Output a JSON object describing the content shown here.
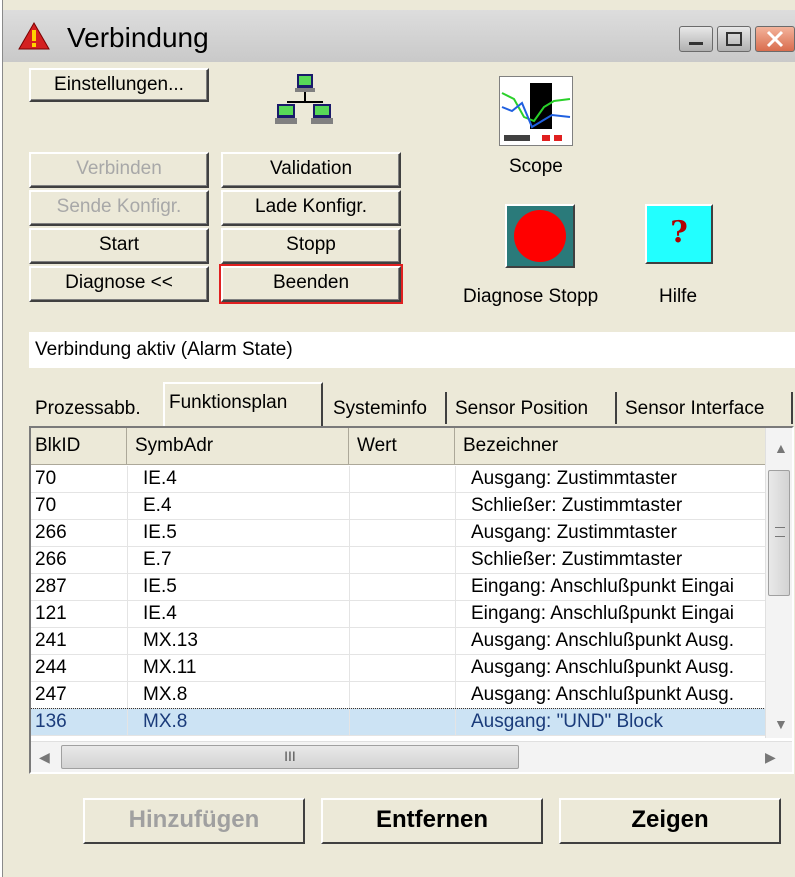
{
  "window": {
    "title": "Verbindung"
  },
  "buttons": {
    "einstellungen": "Einstellungen...",
    "verbinden": "Verbinden",
    "validation": "Validation",
    "sende_konfig": "Sende Konfigr.",
    "lade_konfig": "Lade Konfigr.",
    "start": "Start",
    "stopp": "Stopp",
    "diagnose": "Diagnose <<",
    "beenden": "Beenden"
  },
  "tools": {
    "scope_label": "Scope",
    "diagnose_stopp_label": "Diagnose Stopp",
    "hilfe_label": "Hilfe",
    "hilfe_glyph": "?"
  },
  "status": {
    "text": "Verbindung aktiv (Alarm State)"
  },
  "tabs": [
    {
      "label": "Prozessabb."
    },
    {
      "label": "Funktionsplan"
    },
    {
      "label": "Systeminfo"
    },
    {
      "label": "Sensor Position"
    },
    {
      "label": "Sensor Interface"
    }
  ],
  "table": {
    "columns": [
      "BlkID",
      "SymbAdr",
      "Wert",
      "Bezeichner"
    ],
    "rows": [
      {
        "blkid": "70",
        "symbadr": "IE.4",
        "wert": "",
        "bezeichner": "Ausgang: Zustimmtaster"
      },
      {
        "blkid": "70",
        "symbadr": "E.4",
        "wert": "",
        "bezeichner": "Schließer: Zustimmtaster"
      },
      {
        "blkid": "266",
        "symbadr": "IE.5",
        "wert": "",
        "bezeichner": "Ausgang: Zustimmtaster"
      },
      {
        "blkid": "266",
        "symbadr": "E.7",
        "wert": "",
        "bezeichner": "Schließer: Zustimmtaster"
      },
      {
        "blkid": "287",
        "symbadr": "IE.5",
        "wert": "",
        "bezeichner": "Eingang: Anschlußpunkt Eingai"
      },
      {
        "blkid": "121",
        "symbadr": "IE.4",
        "wert": "",
        "bezeichner": "Eingang: Anschlußpunkt Eingai"
      },
      {
        "blkid": "241",
        "symbadr": "MX.13",
        "wert": "",
        "bezeichner": "Ausgang: Anschlußpunkt Ausg."
      },
      {
        "blkid": "244",
        "symbadr": "MX.11",
        "wert": "",
        "bezeichner": "Ausgang: Anschlußpunkt Ausg."
      },
      {
        "blkid": "247",
        "symbadr": "MX.8",
        "wert": "",
        "bezeichner": "Ausgang: Anschlußpunkt Ausg."
      },
      {
        "blkid": "136",
        "symbadr": "MX.8",
        "wert": "",
        "bezeichner": "Ausgang: \"UND\" Block",
        "selected": true
      }
    ]
  },
  "scrollbar": {
    "grip": "III"
  },
  "bottom": {
    "hinzufuegen": "Hinzufügen",
    "entfernen": "Entfernen",
    "zeigen": "Zeigen"
  },
  "colors": {
    "window_bg": "#ece9d8",
    "stop_red": "#ff0000",
    "stop_bg": "#2a7a7a",
    "help_bg": "#22ffff",
    "focus_frame": "#e02020"
  }
}
